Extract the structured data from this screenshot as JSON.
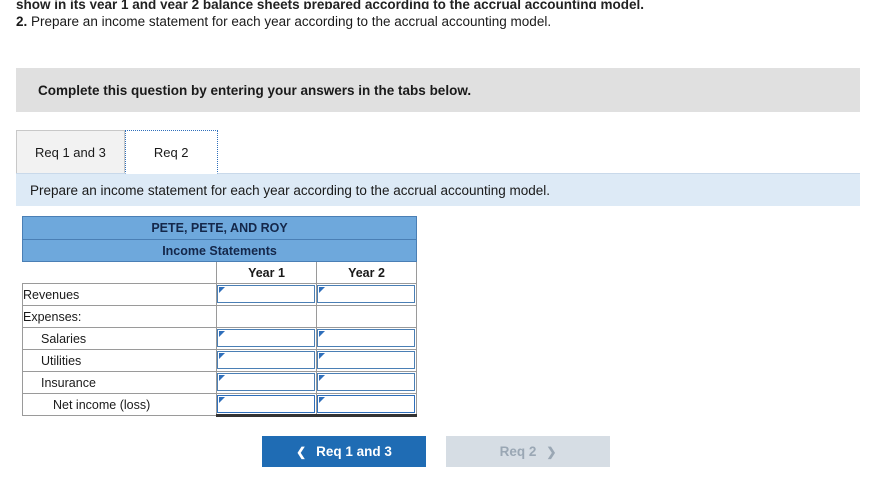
{
  "question": {
    "line1_clipped": "show in its year 1 and year 2 balance sheets prepared according to the accrual accounting model.",
    "line2_number": "2.",
    "line2_text": "Prepare an income statement for each year according to the accrual accounting model."
  },
  "banner": {
    "text": "Complete this question by entering your answers in the tabs below."
  },
  "tabs": [
    {
      "label": "Req 1 and 3",
      "active": false
    },
    {
      "label": "Req 2",
      "active": true
    }
  ],
  "subinstruction": {
    "text": "Prepare an income statement for each year according to the accrual accounting model."
  },
  "worksheet": {
    "title": "PETE, PETE, AND ROY",
    "subtitle": "Income Statements",
    "columns": [
      "Year 1",
      "Year 2"
    ],
    "rows": [
      {
        "label": "Revenues",
        "indent": 0,
        "inputs": [
          "",
          ""
        ],
        "total": false
      },
      {
        "label": "Expenses:",
        "indent": 0,
        "inputs": null,
        "total": false
      },
      {
        "label": "Salaries",
        "indent": 1,
        "inputs": [
          "",
          ""
        ],
        "total": false
      },
      {
        "label": "Utilities",
        "indent": 1,
        "inputs": [
          "",
          ""
        ],
        "total": false
      },
      {
        "label": "Insurance",
        "indent": 1,
        "inputs": [
          "",
          ""
        ],
        "total": false
      },
      {
        "label": "Net income (loss)",
        "indent": 2,
        "inputs": [
          "",
          ""
        ],
        "total": true
      }
    ]
  },
  "nav": {
    "prev_label": "Req 1 and 3",
    "prev_icon": "chevron-left-icon",
    "next_label": "Req 2",
    "next_icon": "chevron-right-icon"
  },
  "colors": {
    "accent": "#1f6cb4",
    "table_header": "#6ea8dc",
    "banner_bg": "#e0e0e0",
    "subinstruction_bg": "#ddeaf6"
  }
}
